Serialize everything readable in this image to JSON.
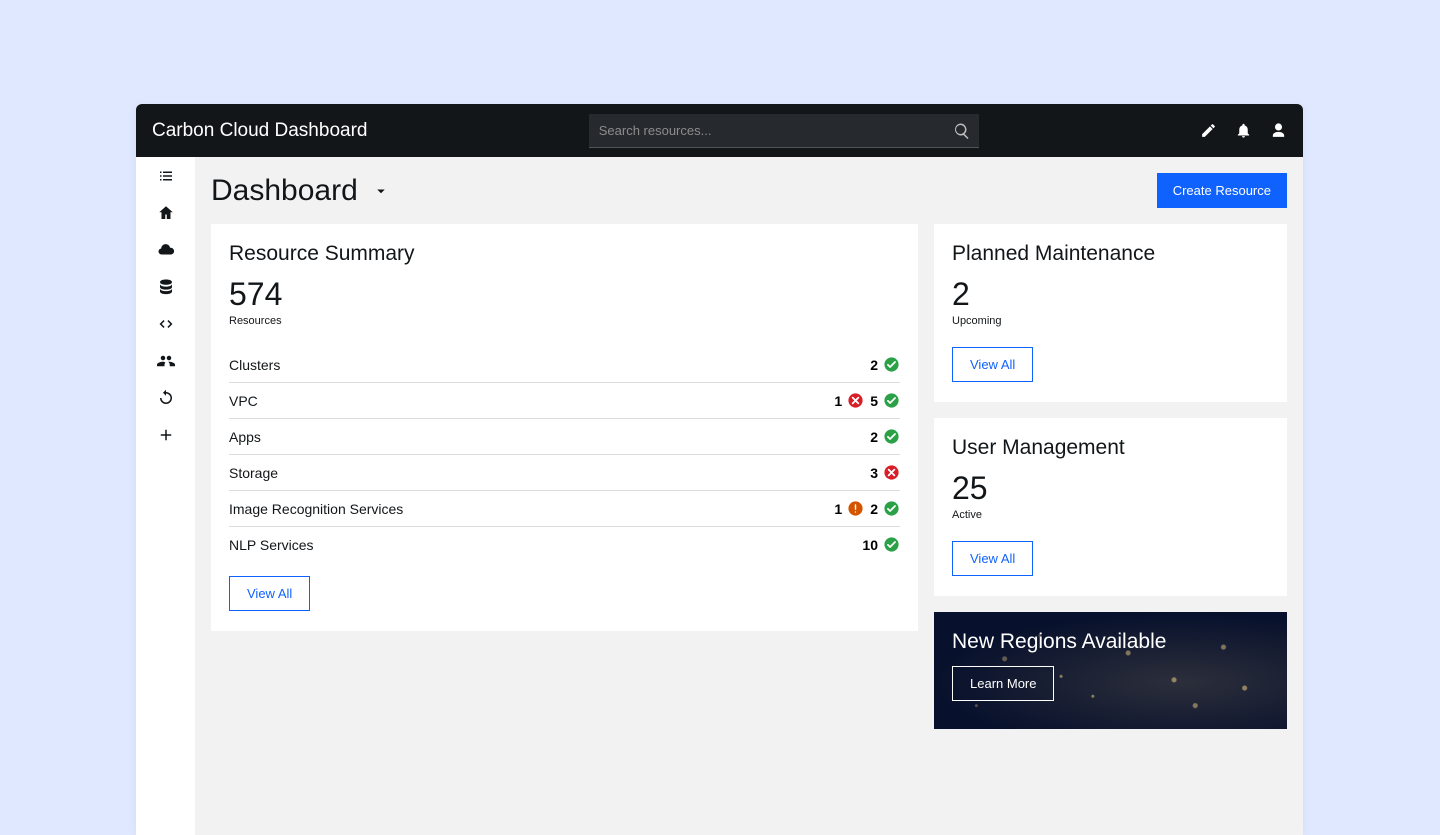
{
  "header": {
    "title": "Carbon Cloud Dashboard",
    "search_placeholder": "Search resources..."
  },
  "page": {
    "title": "Dashboard",
    "create_button": "Create Resource"
  },
  "summary": {
    "title": "Resource Summary",
    "total": "574",
    "total_label": "Resources",
    "view_all": "View All",
    "rows": [
      {
        "name": "Clusters",
        "statuses": [
          {
            "count": "2",
            "type": "ok"
          }
        ]
      },
      {
        "name": "VPC",
        "statuses": [
          {
            "count": "1",
            "type": "error"
          },
          {
            "count": "5",
            "type": "ok"
          }
        ]
      },
      {
        "name": "Apps",
        "statuses": [
          {
            "count": "2",
            "type": "ok"
          }
        ]
      },
      {
        "name": "Storage",
        "statuses": [
          {
            "count": "3",
            "type": "error"
          }
        ]
      },
      {
        "name": "Image Recognition Services",
        "statuses": [
          {
            "count": "1",
            "type": "warn"
          },
          {
            "count": "2",
            "type": "ok"
          }
        ]
      },
      {
        "name": "NLP Services",
        "statuses": [
          {
            "count": "10",
            "type": "ok"
          }
        ]
      }
    ]
  },
  "maintenance": {
    "title": "Planned Maintenance",
    "count": "2",
    "label": "Upcoming",
    "view_all": "View All"
  },
  "users": {
    "title": "User Management",
    "count": "25",
    "label": "Active",
    "view_all": "View All"
  },
  "regions": {
    "title": "New Regions Available",
    "button": "Learn More"
  },
  "colors": {
    "primary": "#1062fe",
    "ok": "#2aa146",
    "error": "#da1e28",
    "warn": "#d45400"
  }
}
